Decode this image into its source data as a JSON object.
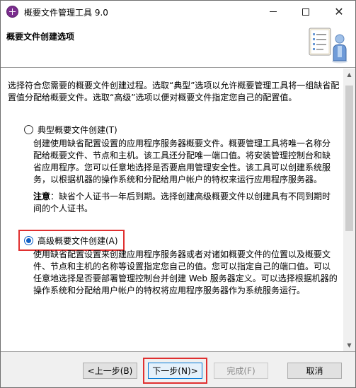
{
  "window": {
    "title": "概要文件管理工具 9.0"
  },
  "header": {
    "title": "概要文件创建选项"
  },
  "content": {
    "intro": "选择符合您需要的概要文件创建过程。选取“典型”选项以允许概要管理工具将一组缺省配置值分配给概要文件。选取“高级”选项以便对概要文件指定您自己的配置值。",
    "typical": {
      "label": "典型概要文件创建(T)",
      "selected": false,
      "description": "创建使用缺省配置设置的应用程序服务器概要文件。概要管理工具将唯一名称分配给概要文件、节点和主机。该工具还分配唯一端口值。将安装管理控制台和缺省应用程序。您可以任意地选择是否要启用管理安全性。该工具可以创建系统服务，以根据机器的操作系统和分配给用户帐户的特权来运行应用程序服务器。",
      "note_label": "注意",
      "note_text": "：缺省个人证书一年后到期。选择创建高级概要文件以创建具有不同到期时间的个人证书。"
    },
    "advanced": {
      "label": "高级概要文件创建(A)",
      "selected": true,
      "description": "使用缺省配置设置来创建应用程序服务器或者对诸如概要文件的位置以及概要文件、节点和主机的名称等设置指定您自己的值。您可以指定自己的端口值。可以任意地选择是否要部署管理控制台并创建 Web 服务器定义。可以选择根据机器的操作系统和分配给用户帐户的特权将应用程序服务器作为系统服务运行。"
    }
  },
  "footer": {
    "back_label": "<上一步(B)",
    "next_label": "下一步(N)>",
    "finish_label": "完成(F)",
    "cancel_label": "取消"
  },
  "colors": {
    "highlight_border": "#e03030",
    "radio_selected": "#0f5fc5",
    "default_button_border": "#0078d7"
  }
}
